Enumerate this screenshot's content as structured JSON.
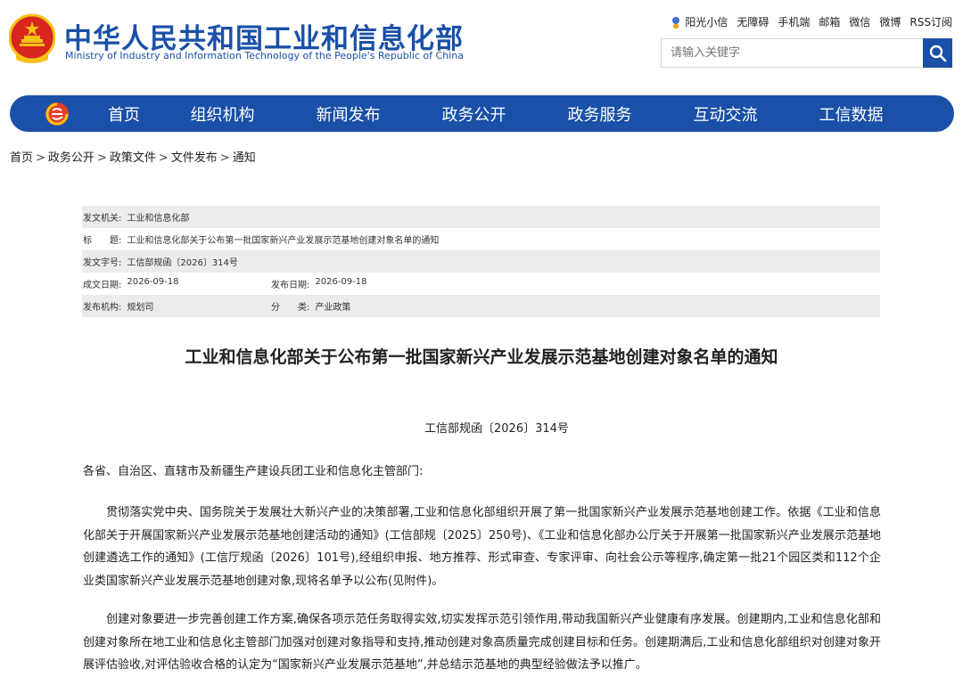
{
  "header": {
    "title_cn": "中华人民共和国工业和信息化部",
    "title_en": "Ministry of Industry and Information Technology of the People's Republic of China",
    "top_links": [
      "阳光小信",
      "无障碍",
      "手机端",
      "邮箱",
      "微信",
      "微博",
      "RSS订阅"
    ],
    "search_placeholder": "请输入关键字"
  },
  "nav": {
    "items": [
      "首页",
      "组织机构",
      "新闻发布",
      "政务公开",
      "政务服务",
      "互动交流",
      "工信数据"
    ]
  },
  "breadcrumb": [
    "首页",
    "政务公开",
    "政策文件",
    "文件发布",
    "通知"
  ],
  "meta": {
    "issuer_label": "发文机关:",
    "issuer": "工业和信息化部",
    "title_label": "标　　题:",
    "title": "工业和信息化部关于公布第一批国家新兴产业发展示范基地创建对象名单的通知",
    "docno_label": "发文字号:",
    "docno": "工信部规函〔2026〕314号",
    "created_label": "成文日期:",
    "created": "2026-09-18",
    "published_label": "发布日期:",
    "published": "2026-09-18",
    "org_label": "发布机构:",
    "org": "规划司",
    "category_label": "分　　类:",
    "category": "产业政策"
  },
  "article": {
    "title": "工业和信息化部关于公布第一批国家新兴产业发展示范基地创建对象名单的通知",
    "docno": "工信部规函〔2026〕314号",
    "salutation": "各省、自治区、直辖市及新疆生产建设兵团工业和信息化主管部门:",
    "para1": "贯彻落实党中央、国务院关于发展壮大新兴产业的决策部署,工业和信息化部组织开展了第一批国家新兴产业发展示范基地创建工作。依据《工业和信息化部关于开展国家新兴产业发展示范基地创建活动的通知》(工信部规〔2025〕250号)、《工业和信息化部办公厅关于开展第一批国家新兴产业发展示范基地创建遴选工作的通知》(工信厅规函〔2026〕101号),经组织申报、地方推荐、形式审查、专家评审、向社会公示等程序,确定第一批21个园区类和112个企业类国家新兴产业发展示范基地创建对象,现将名单予以公布(见附件)。",
    "para2": "创建对象要进一步完善创建工作方案,确保各项示范任务取得实效,切实发挥示范引领作用,带动我国新兴产业健康有序发展。创建期内,工业和信息化部和创建对象所在地工业和信息化主管部门加强对创建对象指导和支持,推动创建对象高质量完成创建目标和任务。创建期满后,工业和信息化部组织对创建对象开展评估验收,对评估验收合格的认定为“国家新兴产业发展示范基地”,并总结示范基地的典型经验做法予以推广。"
  },
  "colors": {
    "brand_blue": "#1a50a8",
    "emblem_red": "#d7261e",
    "emblem_gold": "#f4c315",
    "meta_shade": "#ececec"
  }
}
